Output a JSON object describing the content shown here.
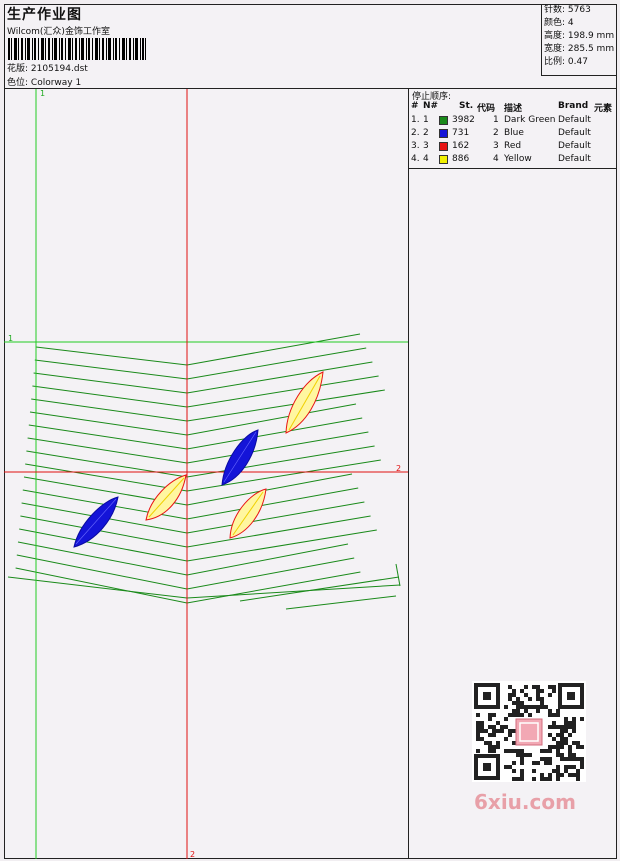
{
  "header": {
    "title": "生产作业图",
    "company": "Wilcom(汇众)金饰工作室",
    "design_label": "花版:",
    "design_value": "2105194.dst",
    "colorway_label": "色位:",
    "colorway_value": "Colorway 1"
  },
  "stats": [
    {
      "label": "针数:",
      "value": "5763"
    },
    {
      "label": "颜色:",
      "value": "4"
    },
    {
      "label": "高度:",
      "value": "198.9 mm"
    },
    {
      "label": "宽度:",
      "value": "285.5 mm"
    },
    {
      "label": "比例:",
      "value": "0.47"
    }
  ],
  "stop_sequence": {
    "title": "停止顺序:",
    "columns": [
      "#",
      "N#",
      "St.",
      "代码",
      "描述",
      "Brand",
      "元素"
    ],
    "rows": [
      {
        "num": "1.",
        "n": "1",
        "color": "#1a8a1a",
        "st": "3982",
        "code": "1",
        "desc": "Dark Green",
        "brand": "Default"
      },
      {
        "num": "2.",
        "n": "2",
        "color": "#1414d8",
        "st": "731",
        "code": "2",
        "desc": "Blue",
        "brand": "Default"
      },
      {
        "num": "3.",
        "n": "3",
        "color": "#e81414",
        "st": "162",
        "code": "3",
        "desc": "Red",
        "brand": "Default"
      },
      {
        "num": "4.",
        "n": "4",
        "color": "#f0f000",
        "st": "886",
        "code": "4",
        "desc": "Yellow",
        "brand": "Default"
      }
    ]
  },
  "axes": {
    "v1_label": "1",
    "h1_label": "1",
    "h2_label": "2",
    "v2_label": "2",
    "green": "#22cc22",
    "red": "#e01010"
  },
  "watermark": {
    "site": "6xiu.com"
  }
}
